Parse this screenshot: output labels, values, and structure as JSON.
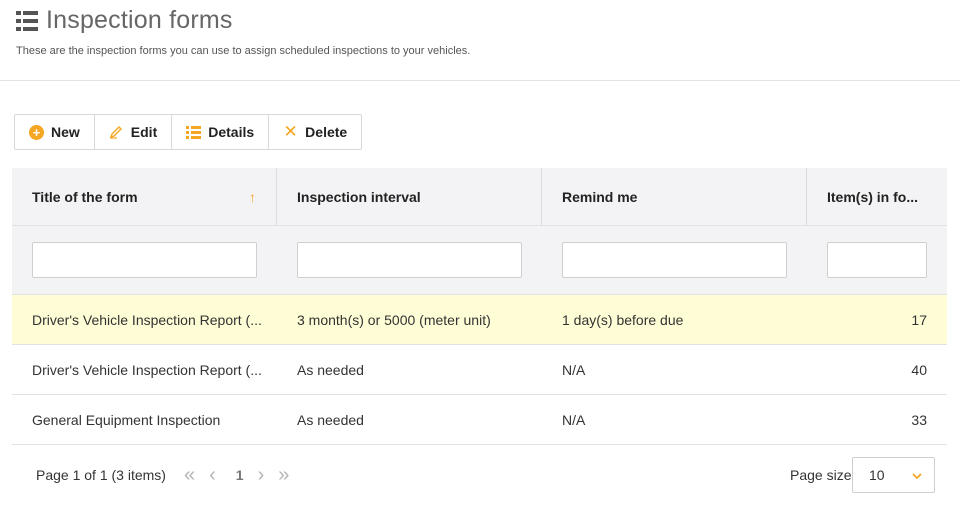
{
  "header": {
    "title": "Inspection forms",
    "subtitle": "These are the inspection forms you can use to assign scheduled inspections to your vehicles.",
    "icon": "list-icon"
  },
  "toolbar": {
    "new_label": "New",
    "edit_label": "Edit",
    "details_label": "Details",
    "delete_label": "Delete"
  },
  "grid": {
    "columns": [
      "Title of the form",
      "Inspection interval",
      "Remind me",
      "Item(s) in fo..."
    ],
    "sorted_column": "Title of the form",
    "sort_direction": "ascending",
    "rows": [
      {
        "title": "Driver's Vehicle Inspection Report (...",
        "interval": "3 month(s) or 5000 (meter unit)",
        "remind": "1 day(s) before due",
        "items": "17",
        "selected": true
      },
      {
        "title": "Driver's Vehicle Inspection Report (...",
        "interval": "As needed",
        "remind": "N/A",
        "items": "40",
        "selected": false
      },
      {
        "title": "General Equipment Inspection",
        "interval": "As needed",
        "remind": "N/A",
        "items": "33",
        "selected": false
      }
    ]
  },
  "pager": {
    "info": "Page 1 of 1 (3 items)",
    "current_page": "1",
    "page_size_label": "Page size:",
    "page_size": "10"
  },
  "colors": {
    "accent": "#f5a623",
    "selected_row": "#fffdd6",
    "header_bg": "#f3f3f5"
  }
}
